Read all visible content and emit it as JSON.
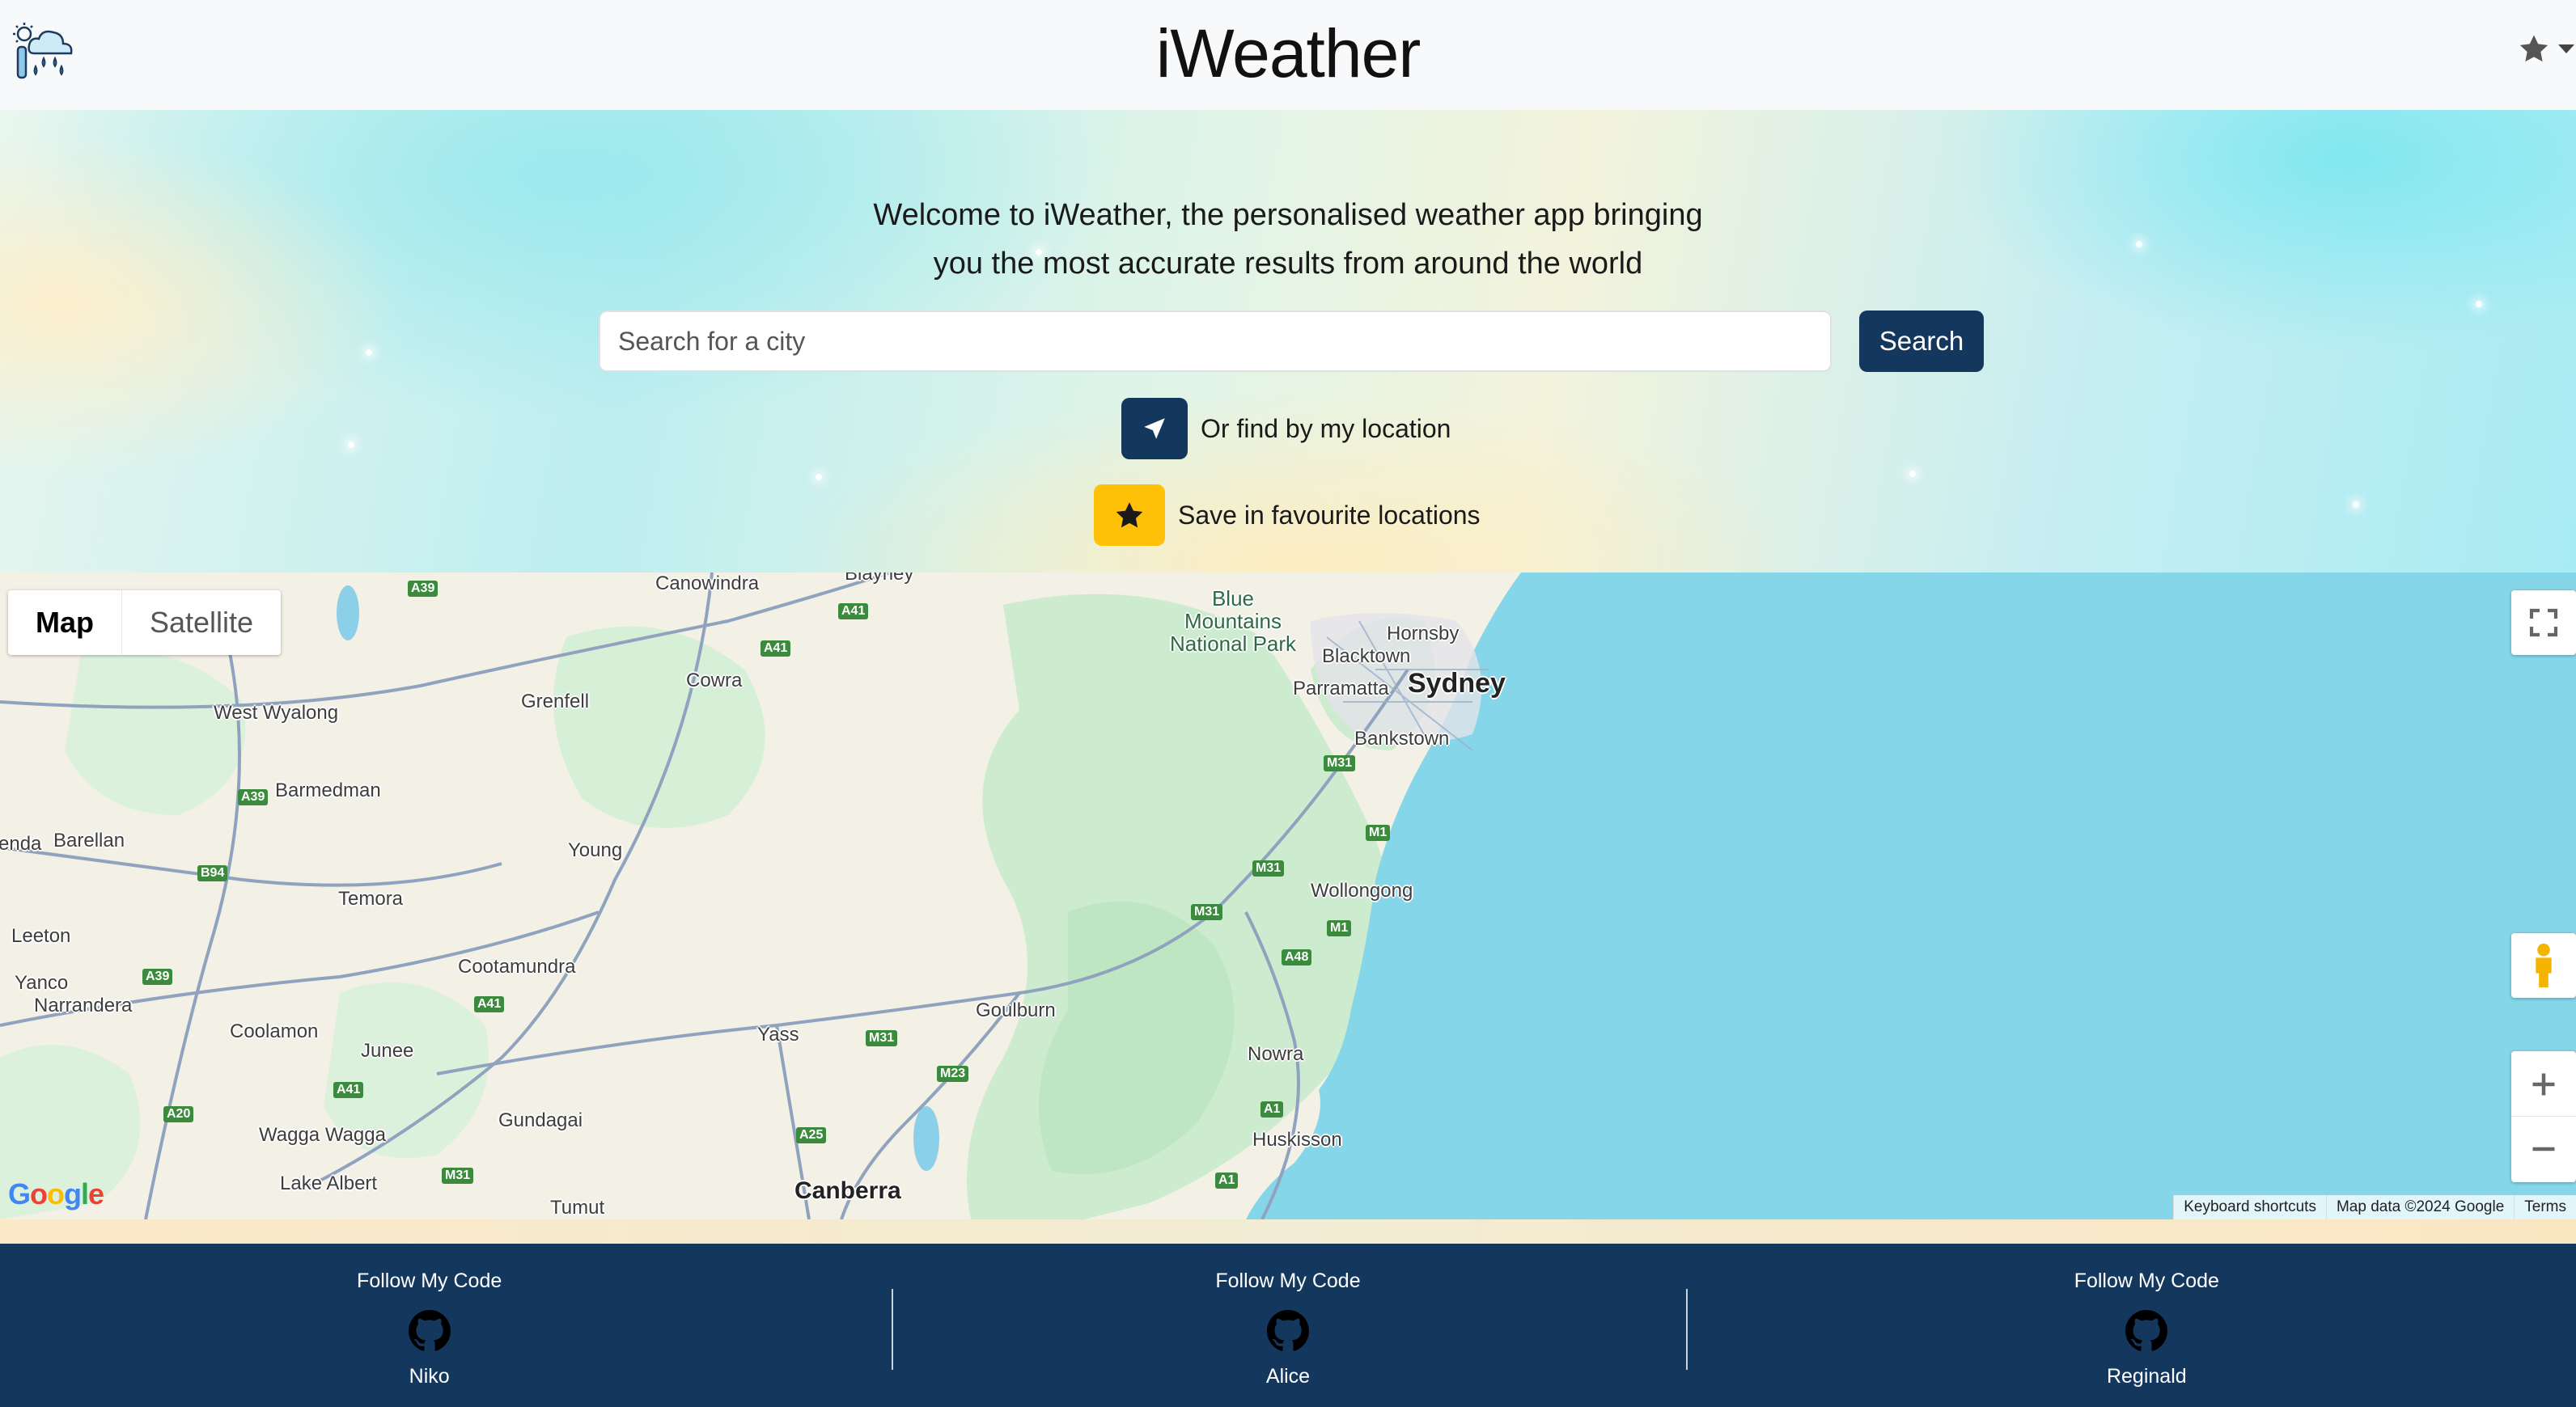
{
  "navbar": {
    "title": "iWeather",
    "logo_icon": "weather-logo-icon",
    "favourites_icon": "star-icon"
  },
  "hero": {
    "welcome_line1": "Welcome to iWeather, the personalised weather app bringing",
    "welcome_line2": "you the most accurate results from around the world",
    "search": {
      "placeholder": "Search for a city",
      "value": ""
    },
    "search_button": "Search",
    "location_label": "Or find by my location",
    "location_icon": "navigation-arrow-icon",
    "favourite_label": "Save in favourite locations",
    "favourite_icon": "star-icon"
  },
  "map": {
    "type_options": [
      "Map",
      "Satellite"
    ],
    "selected_type": "Map",
    "labels": {
      "sydney": "Sydney",
      "canberra": "Canberra",
      "blue_mountains": "Blue Mountains National Park",
      "canowindra": "Canowindra",
      "blayney": "Blayney",
      "cowra": "Cowra",
      "grenfell": "Grenfell",
      "west_wyalong": "West Wyalong",
      "barmedman": "Barmedman",
      "barellan": "Barellan",
      "enda": "enda",
      "temora": "Temora",
      "young": "Young",
      "leeton": "Leeton",
      "yanco": "Yanco",
      "narrandera": "Narrandera",
      "cootamundra": "Cootamundra",
      "coolamon": "Coolamon",
      "junee": "Junee",
      "wagga_wagga": "Wagga Wagga",
      "lake_albert": "Lake Albert",
      "gundagai": "Gundagai",
      "tumut": "Tumut",
      "yass": "Yass",
      "goulburn": "Goulburn",
      "hornsby": "Hornsby",
      "blacktown": "Blacktown",
      "parramatta": "Parramatta",
      "bankstown": "Bankstown",
      "wollongong": "Wollongong",
      "nowra": "Nowra",
      "huskisson": "Huskisson"
    },
    "shields": {
      "a39a": "A39",
      "a41a": "A41",
      "a41b": "A41",
      "a39b": "A39",
      "b94": "B94",
      "a39c": "A39",
      "a41c": "A41",
      "a41d": "A41",
      "a20": "A20",
      "m31a": "M31",
      "m31b": "M31",
      "m23": "M23",
      "a25": "A25",
      "m31c": "M31",
      "m31d": "M31",
      "m31e": "M31",
      "m1a": "M1",
      "m1b": "M1",
      "a48": "A48",
      "a1a": "A1",
      "a1b": "A1"
    },
    "attribution": {
      "shortcuts": "Keyboard shortcuts",
      "data": "Map data ©2024 Google",
      "terms": "Terms"
    },
    "google_logo": "Google",
    "controls": [
      "fullscreen-icon",
      "pegman-icon",
      "zoom-in-icon",
      "zoom-out-icon"
    ]
  },
  "footer": {
    "columns": [
      {
        "heading": "Follow My Code",
        "icon": "github-icon",
        "name": "Niko"
      },
      {
        "heading": "Follow My Code",
        "icon": "github-icon",
        "name": "Alice"
      },
      {
        "heading": "Follow My Code",
        "icon": "github-icon",
        "name": "Reginald"
      }
    ]
  },
  "colors": {
    "primary": "#14375e",
    "favourite": "#ffc107",
    "ocean": "#86d6ea",
    "land": "#f3f0e6",
    "forest": "#cdeccf"
  }
}
